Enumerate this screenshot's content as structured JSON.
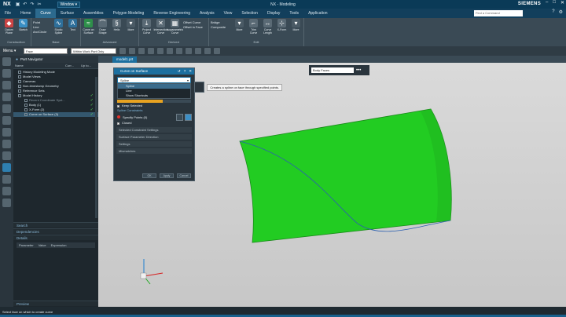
{
  "app": {
    "logo": "NX",
    "title": "NX - Modeling",
    "window_menu": "Window ▾",
    "brand": "SIEMENS"
  },
  "menubar": {
    "tabs": [
      "File",
      "Home",
      "Curve",
      "Surface",
      "Assemblies",
      "Polygon Modeling",
      "Reverse Engineering",
      "Analysis",
      "View",
      "Selection",
      "Display",
      "Tools",
      "Application"
    ],
    "active_tab": "Curve",
    "search_placeholder": "Find a Command"
  },
  "ribbon": {
    "groups": [
      {
        "label": "Construction",
        "buttons": [
          "Datum Plane",
          "Sketch"
        ]
      },
      {
        "label": "Base",
        "list": [
          "Point",
          "Line",
          "Arc/Circle"
        ],
        "buttons": [
          "Studio Spline",
          "Text"
        ]
      },
      {
        "label": "Advanced",
        "buttons": [
          "Curve on Surface",
          "Draw Shape",
          "Helix",
          "More"
        ]
      },
      {
        "label": "Derived",
        "buttons": [
          "Project Curve",
          "Intersection Curve",
          "Isoparametric Curve"
        ],
        "list": [
          "Offset Curve",
          "Offset in Face"
        ]
      },
      {
        "label": "Edit",
        "list": [
          "Bridge",
          "Composite"
        ],
        "buttons": [
          "More",
          "Trim Curve",
          "Curve Length",
          "X-Form",
          "More"
        ]
      }
    ]
  },
  "toolbar2": {
    "menu_label": "Menu ▾",
    "filter_value": "Face",
    "scope_value": "Within Work Part Only"
  },
  "navigator": {
    "title": "Part Navigator",
    "columns": [
      "Name",
      "Curr...",
      "Up to..."
    ],
    "tree": [
      {
        "label": "History Modeling Mode",
        "indent": 0,
        "check": false,
        "dim": false,
        "sel": false
      },
      {
        "label": "Model Views",
        "indent": 0,
        "check": false,
        "dim": false,
        "sel": false
      },
      {
        "label": "Cameras",
        "indent": 0,
        "check": false,
        "dim": false,
        "sel": false
      },
      {
        "label": "Non-timestamp Geometry",
        "indent": 0,
        "check": false,
        "dim": false,
        "sel": false
      },
      {
        "label": "Reference Sets",
        "indent": 0,
        "check": false,
        "dim": false,
        "sel": false
      },
      {
        "label": "Model History",
        "indent": 0,
        "check": true,
        "dim": false,
        "sel": false
      },
      {
        "label": "Recent Coordinate Syst...",
        "indent": 1,
        "check": true,
        "dim": true,
        "sel": false
      },
      {
        "label": "Body (1)",
        "indent": 1,
        "check": true,
        "dim": false,
        "sel": false
      },
      {
        "label": "X-Form (2)",
        "indent": 1,
        "check": true,
        "dim": false,
        "sel": false
      },
      {
        "label": "Curve on Surface (3)",
        "indent": 1,
        "check": true,
        "dim": false,
        "sel": true
      }
    ],
    "panels": [
      "Search",
      "Dependencies",
      "Details",
      "Preview"
    ],
    "param_columns": [
      "Parameter",
      "Value",
      "Expression"
    ]
  },
  "document_tab": "model1.prt",
  "selection_filter": {
    "value": "Body Faces"
  },
  "dialog": {
    "title": "Curve on Surface",
    "type_value": "Spline",
    "type_options": [
      "Spline",
      "Line",
      "Show Shortcuts"
    ],
    "progress": 0.62,
    "keep_selected": "Keep Selected",
    "section_constraints": "Spline Constraints",
    "specify_points": "Specify Points (0)",
    "closed": "Closed",
    "collapsed_sections": [
      "Selected Constraint Settings",
      "Surface Parameter Direction",
      "Settings",
      "Mismatches"
    ],
    "buttons": [
      "OK",
      "Apply",
      "Cancel"
    ]
  },
  "tooltip": {
    "text": "Creates a spline on face through specified points."
  },
  "status": {
    "prompt": "Select face on which to create curve"
  },
  "colors": {
    "title_bar": "#0a3a57",
    "accent": "#1c6f9f",
    "surface_green": "#22cc22",
    "viewport_bg": "#d0d0d0"
  }
}
